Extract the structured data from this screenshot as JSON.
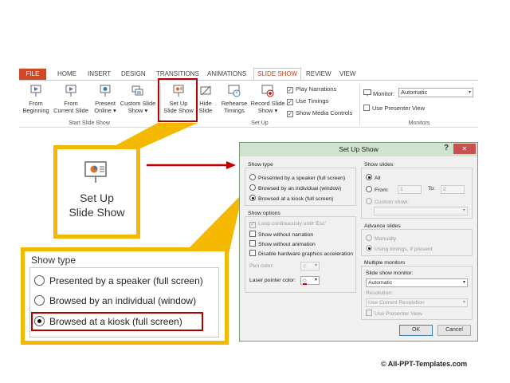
{
  "ribbon": {
    "tabs": [
      {
        "label": "FILE"
      },
      {
        "label": "HOME"
      },
      {
        "label": "INSERT"
      },
      {
        "label": "DESIGN"
      },
      {
        "label": "TRANSITIONS"
      },
      {
        "label": "ANIMATIONS"
      },
      {
        "label": "SLIDE SHOW"
      },
      {
        "label": "REVIEW"
      },
      {
        "label": "VIEW"
      }
    ],
    "start_group": {
      "label": "Start Slide Show",
      "from_beginning": [
        "From",
        "Beginning"
      ],
      "from_current": [
        "From",
        "Current Slide"
      ],
      "present_online": [
        "Present",
        "Online ▾"
      ],
      "custom_show": [
        "Custom Slide",
        "Show ▾"
      ]
    },
    "setup_group": {
      "label": "Set Up",
      "setup_show": [
        "Set Up",
        "Slide Show"
      ],
      "hide_slide": [
        "Hide",
        "Slide"
      ],
      "rehearse": [
        "Rehearse",
        "Timings"
      ],
      "record": [
        "Record Slide",
        "Show ▾"
      ],
      "play_narrations": "Play Narrations",
      "use_timings": "Use Timings",
      "show_media_controls": "Show Media Controls"
    },
    "monitors_group": {
      "label": "Monitors",
      "monitor_label": "Monitor:",
      "monitor_value": "Automatic",
      "presenter_view": "Use Presenter View"
    }
  },
  "callout_small": {
    "line1": "Set Up",
    "line2": "Slide Show"
  },
  "callout_large": {
    "title": "Show type",
    "options": [
      "Presented by a speaker (full screen)",
      "Browsed by an individual (window)",
      "Browsed at a kiosk (full screen)"
    ]
  },
  "dialog": {
    "title": "Set Up Show",
    "help": "?",
    "close": "✕",
    "show_type": {
      "title": "Show type",
      "options": [
        "Presented by a speaker (full screen)",
        "Browsed by an individual (window)",
        "Browsed at a kiosk (full screen)"
      ]
    },
    "show_options": {
      "title": "Show options",
      "loop": "Loop continuously until 'Esc'",
      "no_narration": "Show without narration",
      "no_animation": "Show without animation",
      "no_hw_accel": "Disable hardware graphics acceleration",
      "pen_color": "Pen color:",
      "laser_color": "Laser pointer color:"
    },
    "show_slides": {
      "title": "Show slides",
      "all": "All",
      "from": "From:",
      "from_value": "1",
      "to": "To:",
      "to_value": "2",
      "custom": "Custom show:"
    },
    "advance_slides": {
      "title": "Advance slides",
      "manually": "Manually",
      "timings": "Using timings, if present"
    },
    "multiple_monitors": {
      "title": "Multiple monitors",
      "monitor_label": "Slide show monitor:",
      "monitor_value": "Automatic",
      "resolution_label": "Resolution:",
      "resolution_value": "Use Current Resolution",
      "presenter_view": "Use Presenter View"
    },
    "ok": "OK",
    "cancel": "Cancel"
  },
  "footer": {
    "copyright": "© All-PPT-Templates.com"
  },
  "colors": {
    "file_tab": "#d24726",
    "callout_border": "#f5b800",
    "highlight": "#b00000",
    "arrow": "#c00000",
    "titlebar": "#cfe3cf",
    "close_button": "#c75050"
  }
}
